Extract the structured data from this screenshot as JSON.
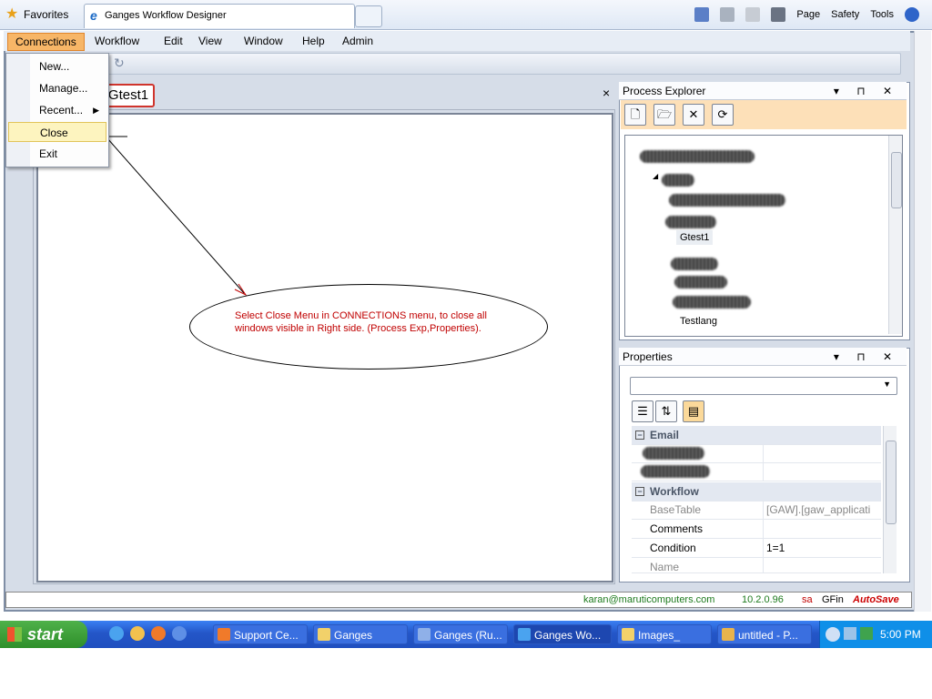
{
  "browser": {
    "favorites_label": "Favorites",
    "tab_title": "Ganges Workflow Designer",
    "tools": {
      "page": "Page",
      "safety": "Safety",
      "tools": "Tools"
    }
  },
  "menubar": {
    "items": [
      "Connections",
      "Workflow",
      "Edit",
      "View",
      "Window",
      "Help",
      "Admin"
    ],
    "active": "Connections"
  },
  "dropdown": {
    "items": [
      {
        "label": "New...",
        "submenu": false
      },
      {
        "label": "Manage...",
        "submenu": false
      },
      {
        "label": "Recent...",
        "submenu": true
      },
      {
        "label": "Close",
        "submenu": false,
        "highlighted": true
      },
      {
        "label": "Exit",
        "submenu": false
      }
    ]
  },
  "document": {
    "tab_label": "Gtest1",
    "close_glyph": "×"
  },
  "callout": {
    "text": "Select Close Menu in CONNECTIONS menu, to close all windows visible in Right side. (Process Exp,Properties)."
  },
  "process_explorer": {
    "title": "Process Explorer",
    "tree_items": [
      "Gtest1",
      "Testlang"
    ]
  },
  "properties": {
    "title": "Properties",
    "categories": [
      {
        "name": "Email"
      },
      {
        "name": "Workflow",
        "rows": [
          {
            "key": "BaseTable",
            "value": "[GAW].[gaw_applicati",
            "disabled": true
          },
          {
            "key": "Comments",
            "value": ""
          },
          {
            "key": "Condition",
            "value": "1=1"
          },
          {
            "key": "Name",
            "value": "",
            "disabled": true
          }
        ]
      }
    ]
  },
  "status": {
    "email": "karan@maruticomputers.com",
    "version": "10.2.0.96",
    "user": "sa",
    "db": "GFin",
    "autosave": "AutoSave"
  },
  "taskbar": {
    "start_label": "start",
    "tasks": [
      "Support Ce...",
      "Ganges",
      "Ganges (Ru...",
      "Ganges Wo...",
      "Images_",
      "untitled - P..."
    ],
    "active_task": "Ganges Wo...",
    "clock": "5:00 PM"
  },
  "colors": {
    "menu_active": "#f7b667",
    "callout_text": "#c00000",
    "autosave": "#cc0000",
    "status_email": "#1e7b1e"
  }
}
